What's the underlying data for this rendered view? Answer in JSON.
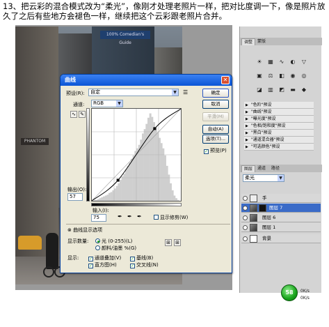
{
  "instruction": "13、把云彩的混合模式改为“柔光”，像刚才处理老照片一样，把对比度调一下，像是照片放久了之后有些地方会褪色一样，继续把这个云彩跟老照片合并。",
  "photo": {
    "sign_text": "100% Comedian's Guide",
    "sign2_text": "PHANTOM"
  },
  "dialog": {
    "title": "曲线",
    "preset_label": "预设(R):",
    "preset_value": "自定",
    "channel_label": "通道:",
    "channel_value": "RGB",
    "output_label": "输出(O):",
    "output_value": "57",
    "input_label": "输入(I):",
    "input_value": "75",
    "show_clipping_label": "显示修剪(W)",
    "curve_options_label": "曲线显示选项",
    "show_amount_label": "显示数量:",
    "radio_light": "光 (0-255)(L)",
    "radio_pigment": "颜料/油墨 %(G)",
    "show_label": "显示:",
    "chk_channel_overlay": "通道叠加(V)",
    "chk_baseline": "基线(B)",
    "chk_histogram": "直方图(H)",
    "chk_intersection": "交叉线(N)",
    "btn_ok": "确定",
    "btn_cancel": "取消",
    "btn_smooth": "平滑(M)",
    "btn_auto": "自动(A)",
    "btn_options": "选项(T)...",
    "chk_preview": "预览(P)"
  },
  "panel": {
    "tabs_top": [
      "调整",
      "蒙版"
    ],
    "tabs_layers": [
      "图层",
      "通道",
      "路径"
    ],
    "blend_mode": "柔光",
    "presets": [
      "\"色阶\"预设",
      "\"曲线\"预设",
      "\"曝光度\"预设",
      "\"色相/饱和度\"预设",
      "\"黑白\"预设",
      "\"通道混合器\"预设",
      "\"可选颜色\"预设"
    ],
    "layers": [
      {
        "name": "手",
        "thumb": "curve"
      },
      {
        "name": "图层 7",
        "thumb": "photo"
      },
      {
        "name": "图层 6",
        "thumb": "photo"
      },
      {
        "name": "图层 1",
        "thumb": "photo"
      },
      {
        "name": "背景",
        "thumb": "white"
      }
    ]
  },
  "status": {
    "indicator": "58",
    "speed_up": "0K/s",
    "speed_down": "0K/s"
  },
  "chart_data": {
    "type": "line",
    "title": "",
    "xlabel": "输入",
    "ylabel": "输出",
    "xlim": [
      0,
      255
    ],
    "ylim": [
      0,
      255
    ],
    "series": [
      {
        "x": [
          0,
          75,
          180,
          255
        ],
        "values": [
          0,
          57,
          200,
          255
        ]
      }
    ],
    "histogram": [
      0,
      1,
      1,
      2,
      3,
      4,
      5,
      6,
      7,
      9,
      10,
      12,
      14,
      17,
      20,
      24,
      28,
      31,
      36,
      40,
      44,
      48,
      52,
      57,
      60,
      64,
      70,
      77,
      82,
      88,
      95,
      100,
      96,
      90,
      84,
      78,
      72,
      66,
      60,
      52,
      40,
      30,
      20,
      12,
      6,
      3,
      1,
      0
    ]
  }
}
